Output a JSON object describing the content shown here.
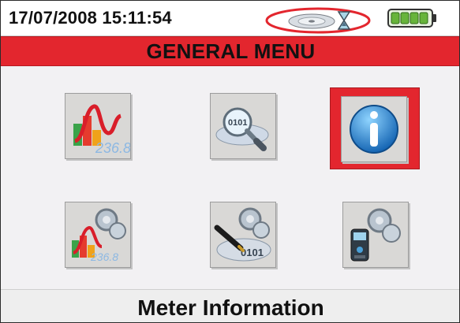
{
  "status_bar": {
    "datetime": "17/07/2008 15:11:54",
    "icons": [
      "cd-recording-icon",
      "hourglass-icon",
      "battery-icon"
    ],
    "highlight_color": "#e3262e"
  },
  "header": {
    "title": "GENERAL MENU",
    "background_color": "#e3262e"
  },
  "menu": {
    "items": [
      {
        "icon": "chart-measurement-icon",
        "selected": false
      },
      {
        "icon": "binary-data-search-icon",
        "selected": false
      },
      {
        "icon": "information-icon",
        "selected": true
      },
      {
        "icon": "chart-settings-icon",
        "selected": false
      },
      {
        "icon": "data-write-settings-icon",
        "selected": false
      },
      {
        "icon": "meter-settings-icon",
        "selected": false
      }
    ]
  },
  "footer": {
    "label": "Meter Information"
  }
}
